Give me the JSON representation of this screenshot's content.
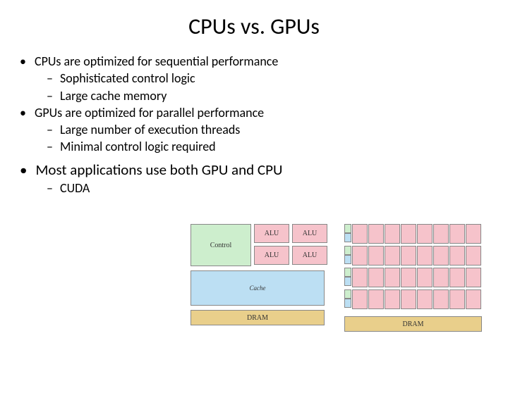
{
  "title": "CPUs vs. GPUs",
  "bullets": {
    "b1": "CPUs are optimized for sequential performance",
    "b1a": "Sophisticated control logic",
    "b1b": "Large cache memory",
    "b2": "GPUs are optimized for parallel performance",
    "b2a": "Large number of execution threads",
    "b2b": "Minimal control logic required",
    "b3": "Most applications use both GPU and CPU",
    "b3a": "CUDA"
  },
  "diagram": {
    "cpu": {
      "control": "Control",
      "alu": "ALU",
      "cache": "Cache",
      "dram": "DRAM"
    },
    "gpu": {
      "dram": "DRAM",
      "rows": 4,
      "alus_per_row": 8
    }
  },
  "colors": {
    "control": "#cdeecd",
    "alu": "#f6c3cb",
    "cache": "#bcdff3",
    "dram": "#e9cf8b"
  }
}
